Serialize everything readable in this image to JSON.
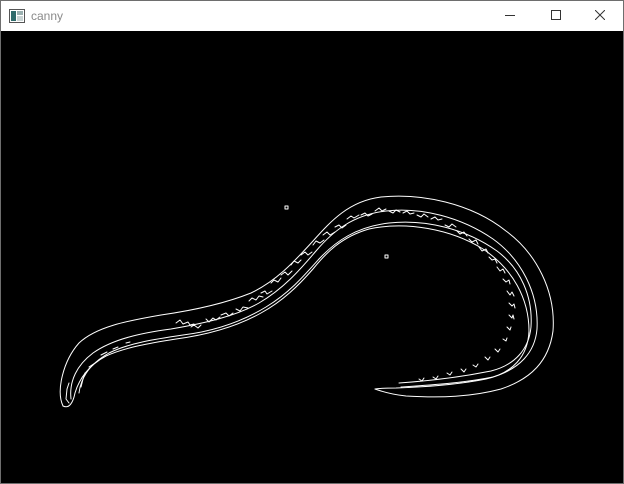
{
  "window": {
    "title": "canny",
    "app_icon": "opencv-window-icon",
    "controls": {
      "minimize_icon": "minimize-icon",
      "maximize_icon": "maximize-icon",
      "close_icon": "close-icon"
    }
  },
  "canvas": {
    "image": "canny-edge-output-nematode",
    "background_color": "#000000",
    "edge_color": "#ffffff"
  }
}
